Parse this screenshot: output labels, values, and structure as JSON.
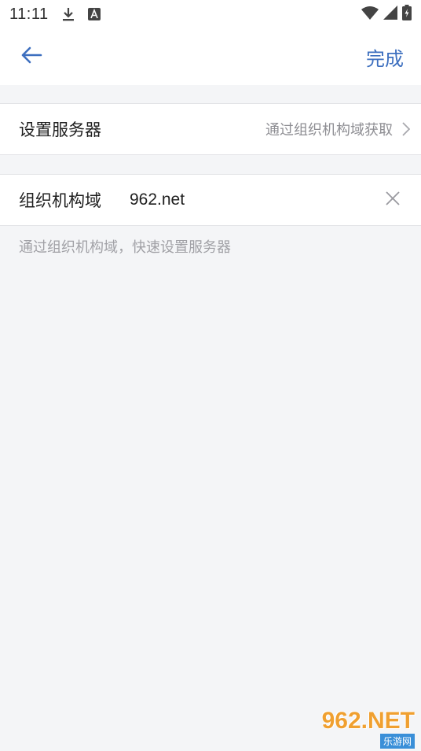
{
  "status_bar": {
    "time": "11:11",
    "icons": [
      "download-icon",
      "text-badge-icon",
      "wifi-icon",
      "signal-icon",
      "battery-icon"
    ]
  },
  "header": {
    "done_label": "完成",
    "accent_color": "#3d6fbf"
  },
  "server_row": {
    "label": "设置服务器",
    "value": "通过组织机构域获取"
  },
  "domain_row": {
    "label": "组织机构域",
    "input_value": "962.net"
  },
  "hint": "通过组织机构域，快速设置服务器",
  "watermark": {
    "main": "962.NET",
    "sub": "乐游网"
  }
}
